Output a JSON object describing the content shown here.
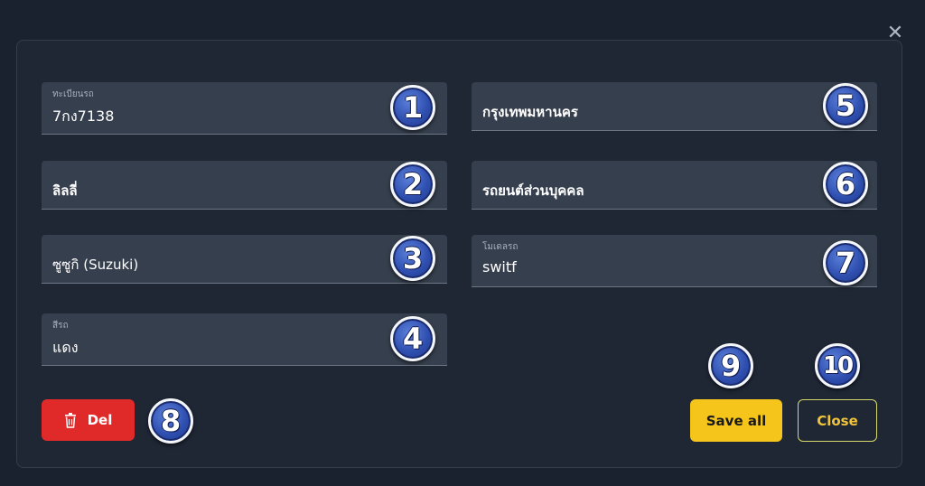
{
  "dialog": {
    "close_glyph": "✕"
  },
  "fields": [
    {
      "label": "ทะเบียนรถ",
      "value": "7กง7138",
      "badge": "1"
    },
    {
      "label": "",
      "value": "ลิลลี่",
      "badge": "2"
    },
    {
      "label": "",
      "value": "ซูซูกิ (Suzuki)",
      "badge": "3"
    },
    {
      "label": "สีรถ",
      "value": "แดง",
      "badge": "4"
    },
    {
      "label": "",
      "value": "กรุงเทพมหานคร",
      "badge": "5"
    },
    {
      "label": "",
      "value": "รถยนต์ส่วนบุคคล",
      "badge": "6"
    },
    {
      "label": "โมเดลรถ",
      "value": "switf",
      "badge": "7"
    }
  ],
  "actions": {
    "delete_label": "Del",
    "delete_badge": "8",
    "save_label": "Save all",
    "save_badge": "9",
    "close_label": "Close",
    "close_badge": "10"
  },
  "icons": {
    "delete": "trash-icon",
    "close": "close-icon"
  },
  "colors": {
    "delete": "#e02a2a",
    "save": "#f6c51c",
    "close_border": "#d6d86a",
    "badge": "#2f4fb0"
  }
}
